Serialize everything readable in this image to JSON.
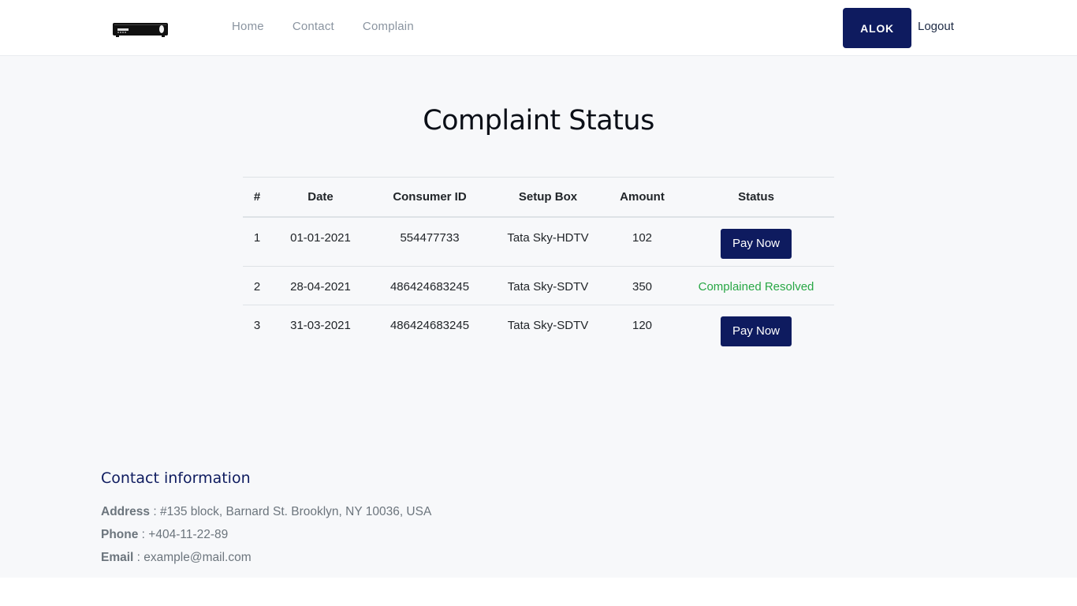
{
  "loading_progress": 0.2,
  "nav": {
    "links": [
      "Home",
      "Contact",
      "Complain"
    ],
    "user_label": "ALOK",
    "logout_label": "Logout"
  },
  "page": {
    "title": "Complaint Status"
  },
  "table": {
    "headers": [
      "#",
      "Date",
      "Consumer ID",
      "Setup Box",
      "Amount",
      "Status"
    ],
    "rows": [
      {
        "num": "1",
        "date": "01-01-2021",
        "consumer_id": "554477733",
        "setup_box": "Tata Sky-HDTV",
        "amount": "102",
        "status": "Pay Now"
      },
      {
        "num": "2",
        "date": "28-04-2021",
        "consumer_id": "486424683245",
        "setup_box": "Tata Sky-SDTV",
        "amount": "350",
        "status": "Complained Resolved"
      },
      {
        "num": "3",
        "date": "31-03-2021",
        "consumer_id": "486424683245",
        "setup_box": "Tata Sky-SDTV",
        "amount": "120",
        "status": "Pay Now"
      }
    ]
  },
  "contact": {
    "title": "Contact information",
    "address_label": "Address",
    "address": "#135 block, Barnard St. Brooklyn, NY 10036, USA",
    "phone_label": "Phone",
    "phone": "+404-11-22-89",
    "email_label": "Email",
    "email": "example@mail.com"
  },
  "colors": {
    "primary": "#0e1b5f",
    "resolved": "#28a745",
    "background": "#f7f8fa"
  },
  "icons": {
    "logo": "set-top-box-icon"
  }
}
